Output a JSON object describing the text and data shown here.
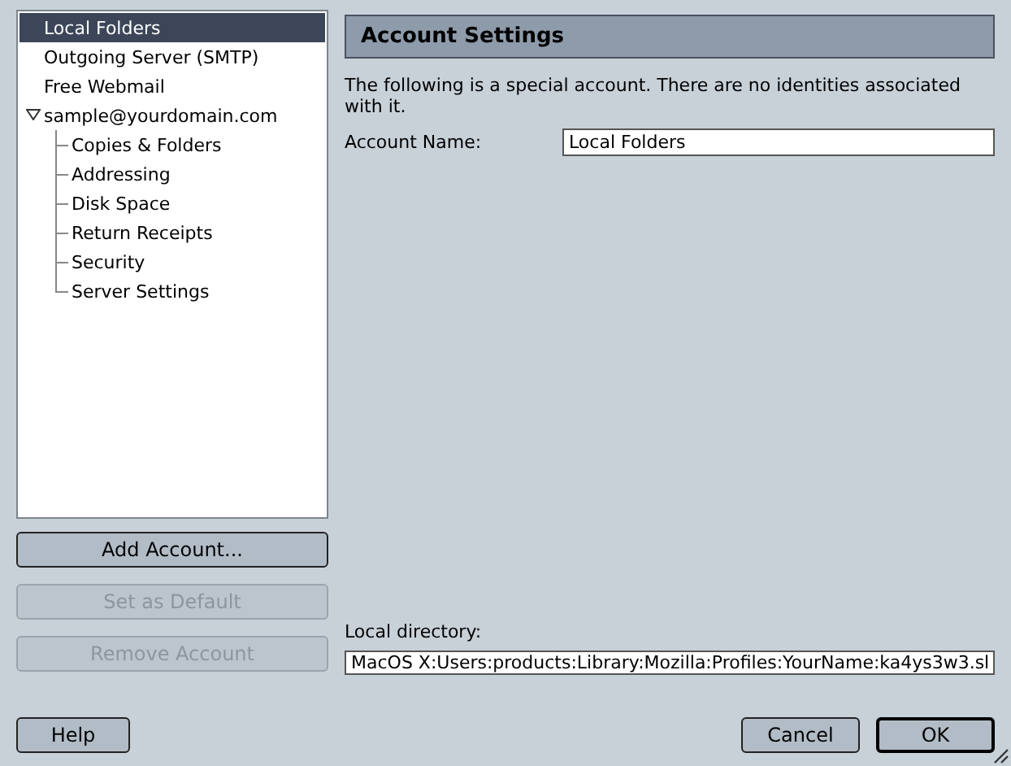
{
  "sidebar": {
    "items": [
      {
        "label": "Local Folders",
        "selected": true
      },
      {
        "label": "Outgoing Server (SMTP)",
        "selected": false
      },
      {
        "label": "Free Webmail",
        "selected": false
      },
      {
        "label": "sample@yourdomain.com",
        "selected": false,
        "expanded": true,
        "children": [
          {
            "label": "Copies & Folders",
            "selected": false
          },
          {
            "label": "Addressing",
            "selected": false
          },
          {
            "label": "Disk Space",
            "selected": false
          },
          {
            "label": "Return Receipts",
            "selected": false
          },
          {
            "label": "Security",
            "selected": false
          },
          {
            "label": "Server Settings",
            "selected": false
          }
        ]
      }
    ]
  },
  "account_buttons": [
    {
      "label": "Add Account...",
      "disabled": false
    },
    {
      "label": "Set as Default",
      "disabled": true
    },
    {
      "label": "Remove Account",
      "disabled": true
    }
  ],
  "panel": {
    "title": "Account Settings",
    "description": "The following is a special account. There are no identities associated with it.",
    "account_name": {
      "label": "Account Name:",
      "value": "Local Folders"
    },
    "local_directory": {
      "label": "Local directory:",
      "value": "MacOS X:Users:products:Library:Mozilla:Profiles:YourName:ka4ys3w3.sl"
    }
  },
  "footer": {
    "help": "Help",
    "buttons": [
      {
        "label": "Cancel",
        "default": false
      },
      {
        "label": "OK",
        "default": true
      }
    ]
  }
}
